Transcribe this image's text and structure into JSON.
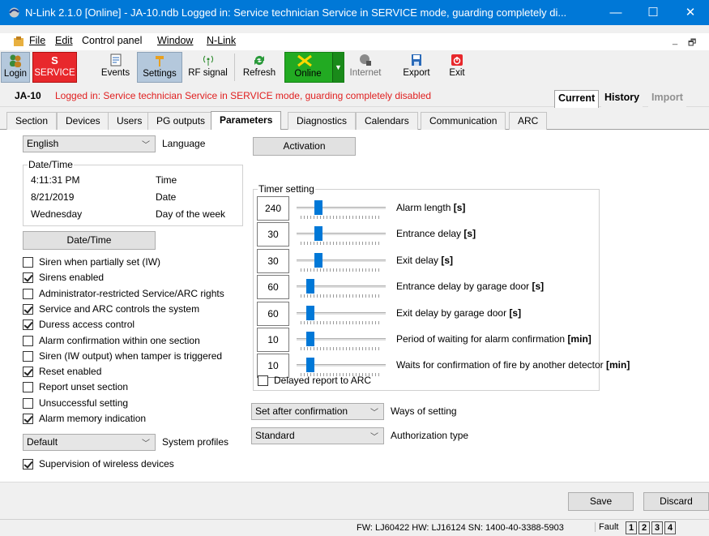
{
  "window": {
    "title": "N-Link 2.1.0 [Online] - JA-10.ndb Logged in: Service technician Service in SERVICE mode, guarding completely di...",
    "min": "—",
    "max": "☐",
    "close": "✕"
  },
  "menu": {
    "file": "File",
    "edit": "Edit",
    "control_panel": "Control panel",
    "window": "Window",
    "nlink": "N-Link",
    "mdi_min": "_",
    "mdi_restore": "🗗"
  },
  "toolbar": {
    "login": "Login",
    "service_letter": "S",
    "service": "SERVICE",
    "events": "Events",
    "settings": "Settings",
    "rf_signal": "RF signal",
    "refresh": "Refresh",
    "online": "Online",
    "internet": "Internet",
    "export": "Export",
    "exit": "Exit"
  },
  "info": {
    "system": "JA-10",
    "message": "Logged in: Service technician Service in SERVICE mode, guarding completely disabled",
    "view_tabs": [
      "Current",
      "History",
      "Import"
    ]
  },
  "tabs": [
    "Section",
    "Devices",
    "Users",
    "PG outputs",
    "Parameters",
    "Diagnostics",
    "Calendars",
    "Communication",
    "ARC"
  ],
  "parameters": {
    "language": {
      "value": "English",
      "label": "Language"
    },
    "datetime": {
      "group": "Date/Time",
      "time_value": "4:11:31 PM",
      "time_label": "Time",
      "date_value": "8/21/2019",
      "date_label": "Date",
      "dow_value": "Wednesday",
      "dow_label": "Day of the week",
      "button": "Date/Time"
    },
    "checkboxes": [
      {
        "label": "Siren when partially set (IW)",
        "checked": false
      },
      {
        "label": "Sirens enabled",
        "checked": true
      },
      {
        "label": "Administrator-restricted Service/ARC rights",
        "checked": false
      },
      {
        "label": "Service and ARC controls the system",
        "checked": true
      },
      {
        "label": "Duress access control",
        "checked": true
      },
      {
        "label": "Alarm confirmation within one section",
        "checked": false
      },
      {
        "label": "Siren (IW output) when tamper is triggered",
        "checked": false
      },
      {
        "label": "Reset enabled",
        "checked": true
      },
      {
        "label": "Report unset section",
        "checked": false
      },
      {
        "label": "Unsuccessful setting",
        "checked": false
      },
      {
        "label": "Alarm memory indication",
        "checked": true
      }
    ],
    "system_profiles": {
      "value": "Default",
      "label": "System profiles"
    },
    "supervision": {
      "label": "Supervision of wireless devices",
      "checked": true
    },
    "activation_button": "Activation",
    "timer": {
      "group": "Timer setting",
      "rows": [
        {
          "value": "240",
          "label": "Alarm length",
          "unit": "[s]",
          "level": 0.22
        },
        {
          "value": "30",
          "label": "Entrance delay",
          "unit": "[s]",
          "level": 0.22
        },
        {
          "value": "30",
          "label": "Exit delay",
          "unit": "[s]",
          "level": 0.22
        },
        {
          "value": "60",
          "label": "Entrance delay by garage door",
          "unit": "[s]",
          "level": 0.12
        },
        {
          "value": "60",
          "label": "Exit delay by garage door",
          "unit": "[s]",
          "level": 0.12
        },
        {
          "value": "10",
          "label": "Period of waiting for alarm confirmation",
          "unit": "[min]",
          "level": 0.12
        },
        {
          "value": "10",
          "label": "Waits for confirmation of fire by another detector",
          "unit": "[min]",
          "level": 0.12
        }
      ],
      "delayed_report": {
        "label": "Delayed report to ARC",
        "checked": false
      }
    },
    "ways_of_setting": {
      "value": "Set after confirmation",
      "label": "Ways of setting"
    },
    "authorization": {
      "value": "Standard",
      "label": "Authorization type"
    }
  },
  "actions": {
    "save": "Save",
    "discard": "Discard"
  },
  "status": {
    "fw": "FW: LJ60422 HW: LJ16124 SN: 1400-40-3388-5903",
    "fault": "Fault",
    "sections": [
      "1",
      "2",
      "3",
      "4"
    ]
  },
  "colors": {
    "title_bg": "#0078d7",
    "service_red": "#e8282c",
    "online_green": "#22aa22",
    "message_red": "#e02020"
  }
}
